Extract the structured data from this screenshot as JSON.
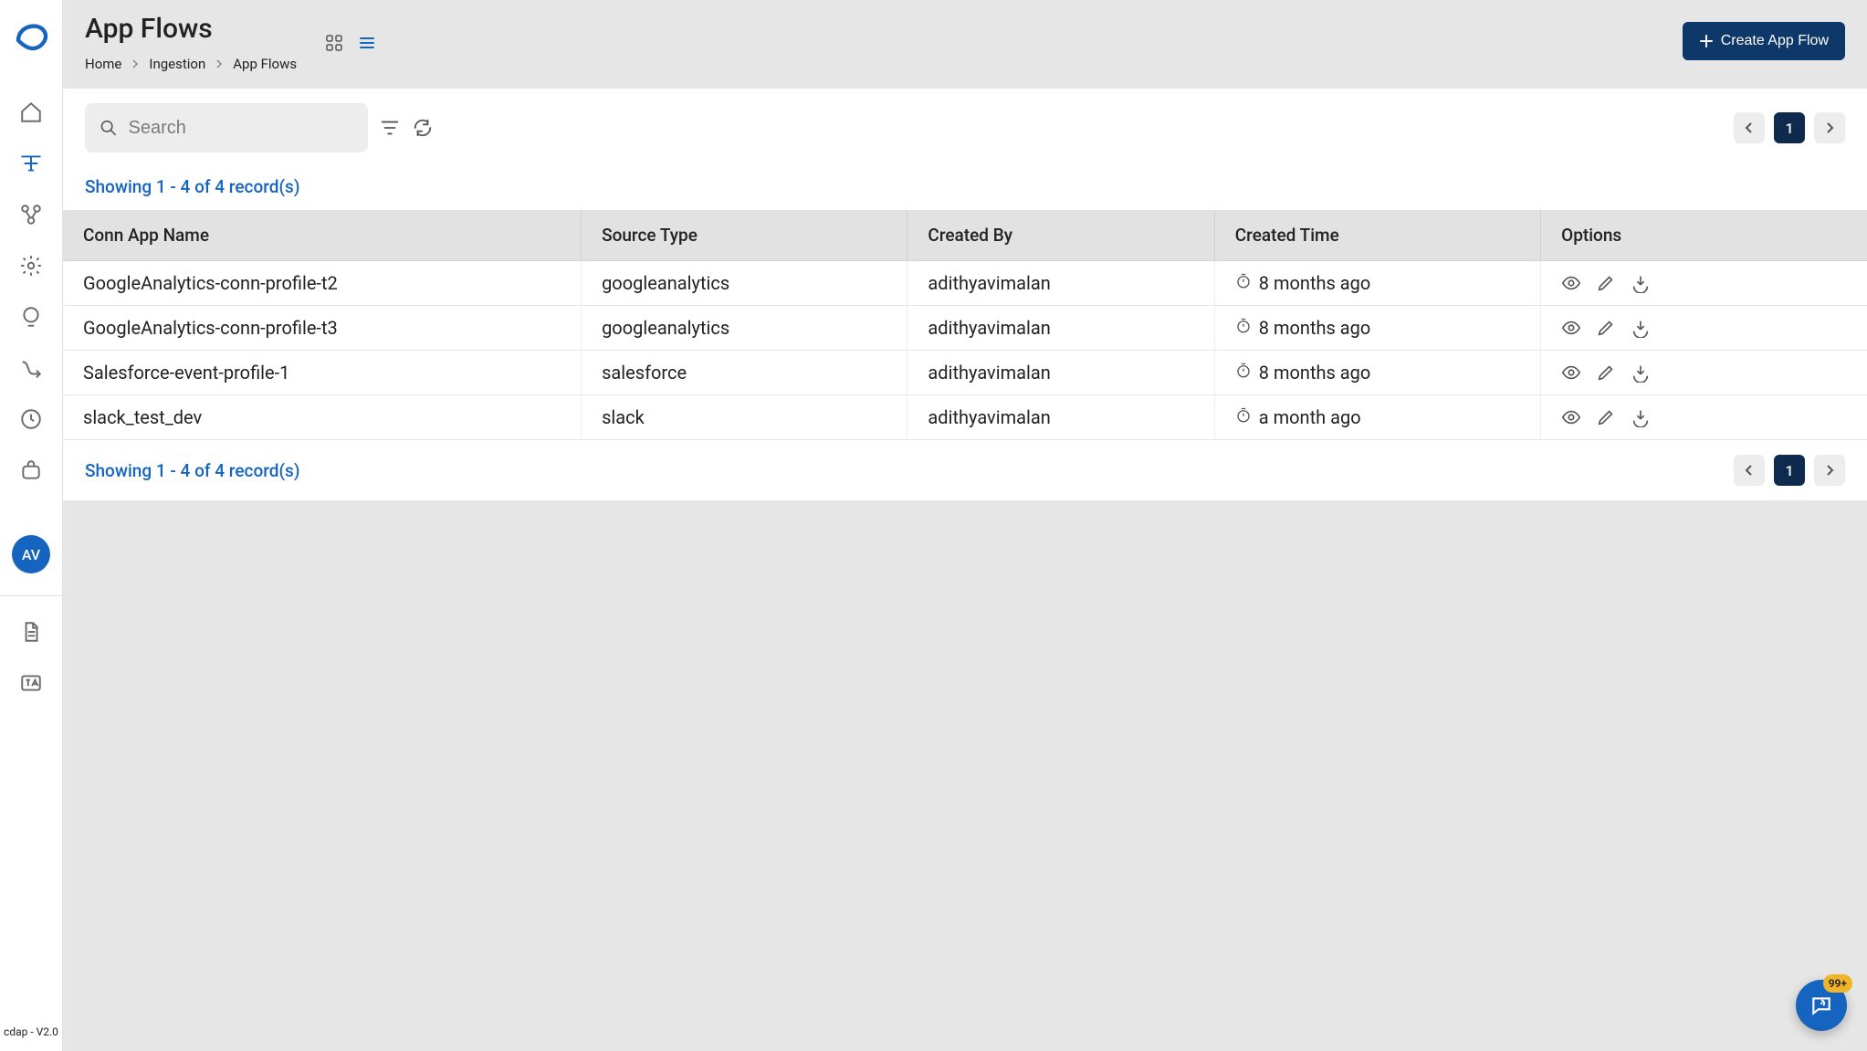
{
  "sidebar": {
    "avatar_initials": "AV",
    "version": "cdap - V2.0"
  },
  "header": {
    "title": "App Flows",
    "breadcrumb": [
      "Home",
      "Ingestion",
      "App Flows"
    ],
    "create_label": "Create App Flow"
  },
  "toolbar": {
    "search_placeholder": "Search",
    "page_number": "1"
  },
  "records_text": "Showing 1 - 4 of 4 record(s)",
  "table": {
    "headers": [
      "Conn App Name",
      "Source Type",
      "Created By",
      "Created Time",
      "Options"
    ],
    "rows": [
      {
        "name": "GoogleAnalytics-conn-profile-t2",
        "source": "googleanalytics",
        "createdBy": "adithyavimalan",
        "createdTime": "8 months ago"
      },
      {
        "name": "GoogleAnalytics-conn-profile-t3",
        "source": "googleanalytics",
        "createdBy": "adithyavimalan",
        "createdTime": "8 months ago"
      },
      {
        "name": "Salesforce-event-profile-1",
        "source": "salesforce",
        "createdBy": "adithyavimalan",
        "createdTime": "8 months ago"
      },
      {
        "name": "slack_test_dev",
        "source": "slack",
        "createdBy": "adithyavimalan",
        "createdTime": "a month ago"
      }
    ]
  },
  "chat_badge": "99+",
  "icons": {
    "nav": [
      "home",
      "pipeline",
      "workflow",
      "settings",
      "alerts",
      "routes",
      "clock",
      "bag"
    ]
  }
}
